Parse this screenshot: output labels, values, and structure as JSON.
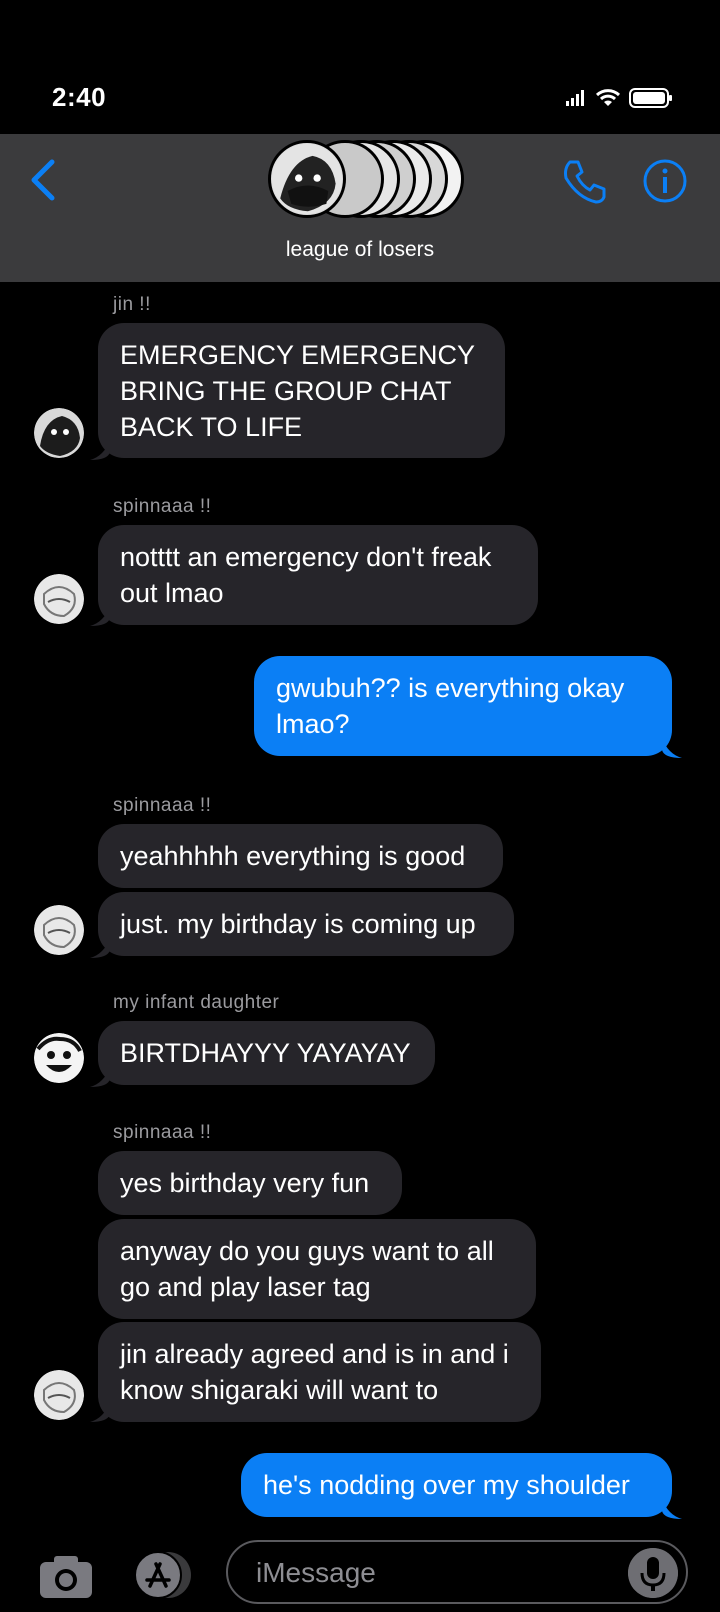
{
  "status": {
    "time": "2:40"
  },
  "header": {
    "group_name": "league of losers"
  },
  "messages": [
    {
      "sender": "jin !!",
      "text": "EMERGENCY EMERGENCY\nBRING THE GROUP CHAT\nBACK TO LIFE"
    },
    {
      "sender": "spinnaaa !!",
      "text": "notttt an emergency don't freak\nout lmao"
    },
    {
      "text": "gwubuh?? is everything okay\nlmao?"
    },
    {
      "sender": "spinnaaa !!",
      "text": "yeahhhhh everything is good"
    },
    {
      "text": "just. my birthday is coming up"
    },
    {
      "sender": "my infant daughter",
      "text": "BIRTDHAYYY YAYAYAY"
    },
    {
      "sender": "spinnaaa !!",
      "text": "yes birthday very fun"
    },
    {
      "text": "anyway do you guys want to all\ngo and play laser tag"
    },
    {
      "text": "jin already agreed and is in and i\nknow shigaraki will want to"
    },
    {
      "text": "he's nodding over my shoulder"
    }
  ],
  "composer": {
    "placeholder": "iMessage"
  },
  "colors": {
    "accent": "#0b7ff5",
    "incoming": "#26252a",
    "header": "#3b3b3d"
  }
}
